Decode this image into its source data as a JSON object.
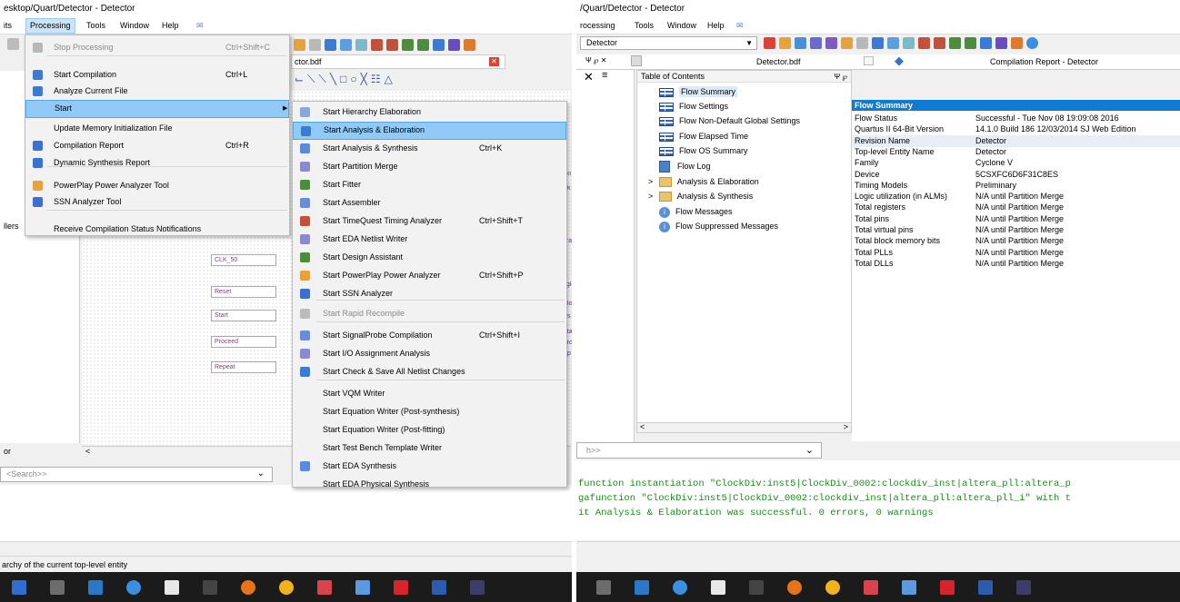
{
  "left": {
    "title": "esktop/Quart/Detector - Detector",
    "menubar": [
      "its",
      "Processing",
      "Tools",
      "Window",
      "Help"
    ],
    "tab_label": "ctor.bdf",
    "processing_menu": [
      {
        "label": "Stop Processing",
        "shortcut": "Ctrl+Shift+C",
        "disabled": true,
        "icon": "stop-icon"
      },
      {
        "label": "Start Compilation",
        "shortcut": "Ctrl+L",
        "icon": "play-icon"
      },
      {
        "label": "Analyze Current File",
        "shortcut": "",
        "icon": "analyze-icon"
      },
      {
        "label": "Start",
        "shortcut": "",
        "highlighted": true,
        "submenu": true
      },
      {
        "label": "Update Memory Initialization File",
        "shortcut": ""
      },
      {
        "label": "Compilation Report",
        "shortcut": "Ctrl+R",
        "icon": "report-icon"
      },
      {
        "label": "Dynamic Synthesis Report",
        "shortcut": "",
        "icon": "report-icon"
      },
      {
        "label": "PowerPlay Power Analyzer Tool",
        "shortcut": "",
        "icon": "power-icon"
      },
      {
        "label": "SSN Analyzer Tool",
        "shortcut": "",
        "icon": "ssn-icon"
      },
      {
        "label": "Receive Compilation Status Notifications",
        "shortcut": ""
      }
    ],
    "start_submenu": [
      {
        "label": "Start Hierarchy Elaboration",
        "shortcut": ""
      },
      {
        "label": "Start Analysis & Elaboration",
        "shortcut": "",
        "highlighted": true
      },
      {
        "label": "Start Analysis & Synthesis",
        "shortcut": "Ctrl+K"
      },
      {
        "label": "Start Partition Merge",
        "shortcut": ""
      },
      {
        "label": "Start Fitter",
        "shortcut": ""
      },
      {
        "label": "Start Assembler",
        "shortcut": ""
      },
      {
        "label": "Start TimeQuest Timing Analyzer",
        "shortcut": "Ctrl+Shift+T"
      },
      {
        "label": "Start EDA Netlist Writer",
        "shortcut": ""
      },
      {
        "label": "Start Design Assistant",
        "shortcut": ""
      },
      {
        "label": "Start PowerPlay Power Analyzer",
        "shortcut": "Ctrl+Shift+P"
      },
      {
        "label": "Start SSN Analyzer",
        "shortcut": ""
      },
      {
        "label": "Start Rapid Recompile",
        "shortcut": "",
        "disabled": true
      },
      {
        "label": "Start SignalProbe Compilation",
        "shortcut": "Ctrl+Shift+I"
      },
      {
        "label": "Start I/O Assignment Analysis",
        "shortcut": ""
      },
      {
        "label": "Start Check & Save All Netlist Changes",
        "shortcut": ""
      },
      {
        "label": "Start VQM Writer",
        "shortcut": ""
      },
      {
        "label": "Start Equation Writer (Post-synthesis)",
        "shortcut": ""
      },
      {
        "label": "Start Equation Writer (Post-fitting)",
        "shortcut": ""
      },
      {
        "label": "Start Test Bench Template Writer",
        "shortcut": ""
      },
      {
        "label": "Start EDA Synthesis",
        "shortcut": ""
      },
      {
        "label": "Start EDA Physical Synthesis",
        "shortcut": ""
      }
    ],
    "side_label_1": "llers",
    "side_label_2": "or",
    "search_placeholder": "<Search>>",
    "ports": [
      "CLK_50",
      "Reset",
      "Start",
      "Proceed",
      "Repeat"
    ],
    "right_edge_labels": [
      "dki",
      "clk",
      "era",
      "ogle",
      "Clo",
      "Rs",
      "Sta",
      "Pro",
      "Rp"
    ],
    "status_text": "archy of the current top-level entity"
  },
  "right": {
    "title": "/Quart/Detector - Detector",
    "menubar": [
      "rocessing",
      "Tools",
      "Window",
      "Help"
    ],
    "entity_dropdown": "Detector",
    "tab_bdf": "Detector.bdf",
    "tab_report": "Compilation Report - Detector",
    "toc_title": "Table of Contents",
    "toc_items": [
      {
        "label": "Flow Summary",
        "icon": "table-icon",
        "selected": true
      },
      {
        "label": "Flow Settings",
        "icon": "table-icon"
      },
      {
        "label": "Flow Non-Default Global Settings",
        "icon": "table-icon"
      },
      {
        "label": "Flow Elapsed Time",
        "icon": "table-icon"
      },
      {
        "label": "Flow OS Summary",
        "icon": "table-icon"
      },
      {
        "label": "Flow Log",
        "icon": "log-icon"
      },
      {
        "label": "Analysis & Elaboration",
        "icon": "folder-icon",
        "expander": true
      },
      {
        "label": "Analysis & Synthesis",
        "icon": "folder-icon",
        "expander": true
      },
      {
        "label": "Flow Messages",
        "icon": "info-icon"
      },
      {
        "label": "Flow Suppressed Messages",
        "icon": "info-icon"
      }
    ],
    "summary_header": "Flow Summary",
    "summary_rows": [
      [
        "Flow Status",
        "Successful - Tue Nov 08 19:09:08 2016"
      ],
      [
        "Quartus II 64-Bit Version",
        "14.1.0 Build 186 12/03/2014 SJ Web Edition"
      ],
      [
        "Revision Name",
        "Detector"
      ],
      [
        "Top-level Entity Name",
        "Detector"
      ],
      [
        "Family",
        "Cyclone V"
      ],
      [
        "Device",
        "5CSXFC6D6F31C8ES"
      ],
      [
        "Timing Models",
        "Preliminary"
      ],
      [
        "Logic utilization (in ALMs)",
        "N/A until Partition Merge"
      ],
      [
        "Total registers",
        "N/A until Partition Merge"
      ],
      [
        "Total pins",
        "N/A until Partition Merge"
      ],
      [
        "Total virtual pins",
        "N/A until Partition Merge"
      ],
      [
        "Total block memory bits",
        "N/A until Partition Merge"
      ],
      [
        "Total PLLs",
        "N/A until Partition Merge"
      ],
      [
        "Total DLLs",
        "N/A until Partition Merge"
      ]
    ],
    "search_placeholder": "h>>",
    "messages": [
      "function instantiation \"ClockDiv:inst5|ClockDiv_0002:clockdiv_inst|altera_pll:altera_p",
      "gafunction \"ClockDiv:inst5|ClockDiv_0002:clockdiv_inst|altera_pll:altera_pll_i\" with t",
      "it Analysis & Elaboration was successful. 0 errors, 0 warnings"
    ]
  },
  "colors": {
    "highlight": "#91c9f7",
    "message_green": "#1d8a1d",
    "report_header": "#0e7bd4"
  }
}
